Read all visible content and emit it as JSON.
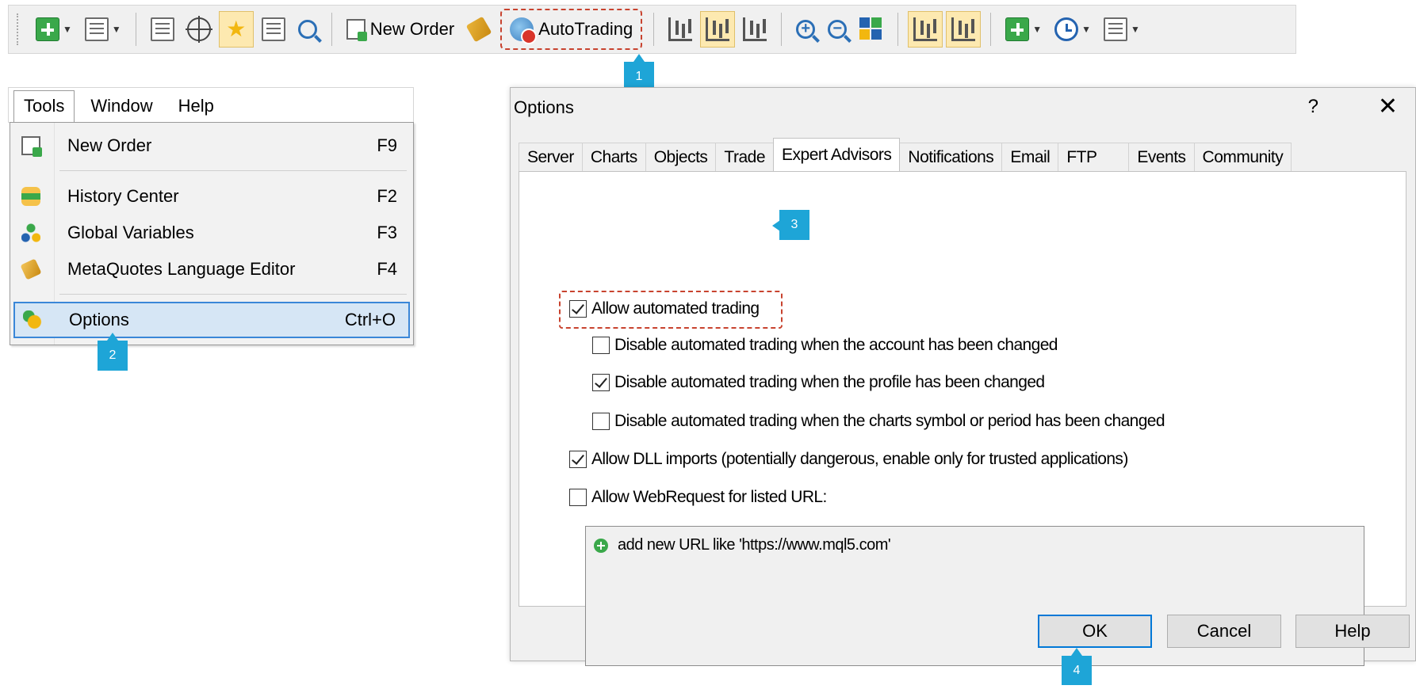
{
  "toolbar": {
    "new_order_label": "New Order",
    "autotrading_label": "AutoTrading"
  },
  "steps": {
    "step1": "1",
    "step2": "2",
    "step3": "3",
    "step4": "4"
  },
  "menu": {
    "bar": [
      {
        "label": "Tools",
        "active": true
      },
      {
        "label": "Window",
        "active": false
      },
      {
        "label": "Help",
        "active": false
      }
    ],
    "items": [
      {
        "label": "New Order",
        "shortcut": "F9",
        "icon": "new-order-icon"
      },
      {
        "label": "History Center",
        "shortcut": "F2",
        "icon": "history-center-icon"
      },
      {
        "label": "Global Variables",
        "shortcut": "F3",
        "icon": "global-variables-icon"
      },
      {
        "label": "MetaQuotes Language Editor",
        "shortcut": "F4",
        "icon": "language-editor-icon"
      },
      {
        "label": "Options",
        "shortcut": "Ctrl+O",
        "icon": "options-icon",
        "highlighted": true
      }
    ]
  },
  "dialog": {
    "title": "Options",
    "help_glyph": "?",
    "close_glyph": "✕",
    "tabs": [
      {
        "label": "Server"
      },
      {
        "label": "Charts"
      },
      {
        "label": "Objects"
      },
      {
        "label": "Trade"
      },
      {
        "label": "Expert Advisors",
        "selected": true
      },
      {
        "label": "Notifications"
      },
      {
        "label": "Email"
      },
      {
        "label": "FTP"
      },
      {
        "label": "Events"
      },
      {
        "label": "Community"
      }
    ],
    "options": {
      "allow_automated_trading": {
        "label": "Allow automated trading",
        "checked": true
      },
      "disable_on_account_change": {
        "label": "Disable automated trading when the account has been changed",
        "checked": false
      },
      "disable_on_profile_change": {
        "label": "Disable automated trading when the profile has been changed",
        "checked": true
      },
      "disable_on_symbol_change": {
        "label": "Disable automated trading when the charts symbol or period has been changed",
        "checked": false
      },
      "allow_dll_imports": {
        "label": "Allow DLL imports (potentially dangerous, enable only for trusted applications)",
        "checked": true
      },
      "allow_webrequest": {
        "label": "Allow WebRequest for listed URL:",
        "checked": false
      }
    },
    "url_list": {
      "add_hint": "add new URL like 'https://www.mql5.com'"
    },
    "buttons": {
      "ok": "OK",
      "cancel": "Cancel",
      "help": "Help"
    }
  },
  "colors": {
    "highlight_dash": "#c8432f",
    "step_badge": "#1ea5d7",
    "menu_highlight": "#d6e6f5",
    "default_button_border": "#0078d7"
  }
}
